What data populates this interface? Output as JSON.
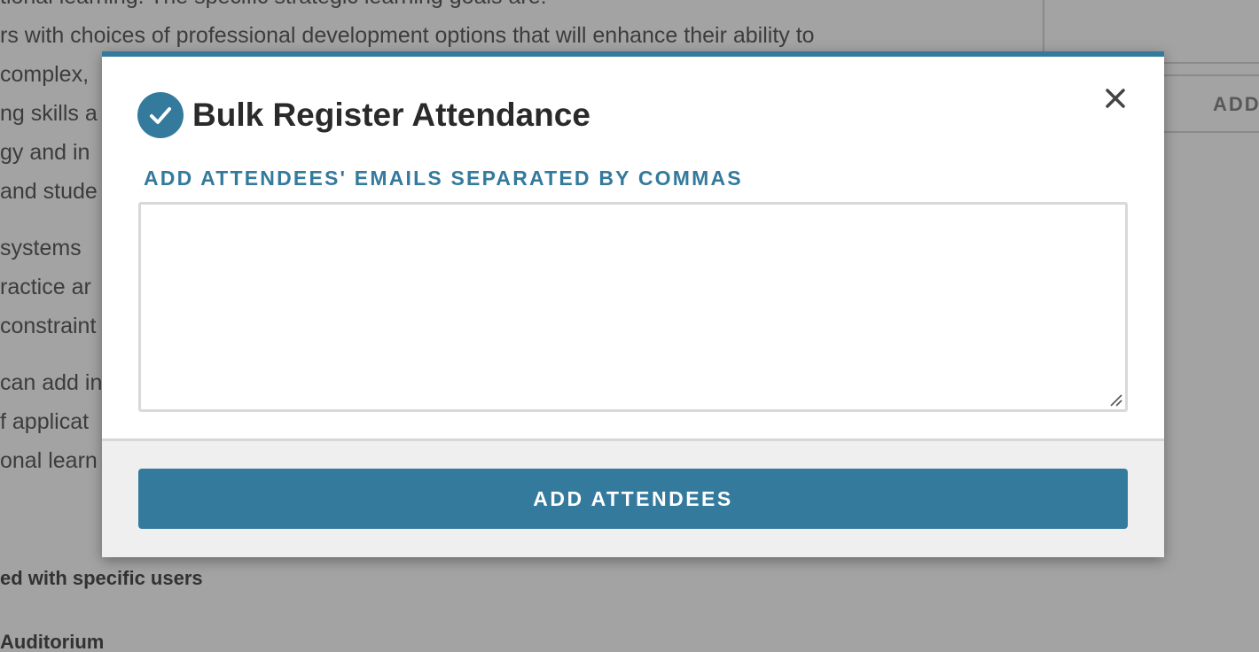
{
  "background": {
    "lines": [
      "tional learning.  The specific strategic learning goals are:",
      "rs with choices of professional development options that will enhance their ability to",
      " complex,",
      "ng skills a",
      "gy and in",
      "and stude",
      "",
      " systems",
      "ractice ar",
      "constraint",
      "",
      "can add in",
      "f applicat",
      "onal learn"
    ],
    "strong_line_1": "ed with specific users",
    "strong_line_2": " Auditorium",
    "right_button_label": "ADD"
  },
  "modal": {
    "title": "Bulk Register Attendance",
    "field_label": "ADD ATTENDEES' EMAILS SEPARATED BY COMMAS",
    "textarea_value": "",
    "submit_label": "ADD ATTENDEES",
    "icons": {
      "header": "check-circle-icon",
      "close": "close-icon"
    },
    "colors": {
      "accent": "#347a9d",
      "footer_bg": "#efefef"
    }
  }
}
